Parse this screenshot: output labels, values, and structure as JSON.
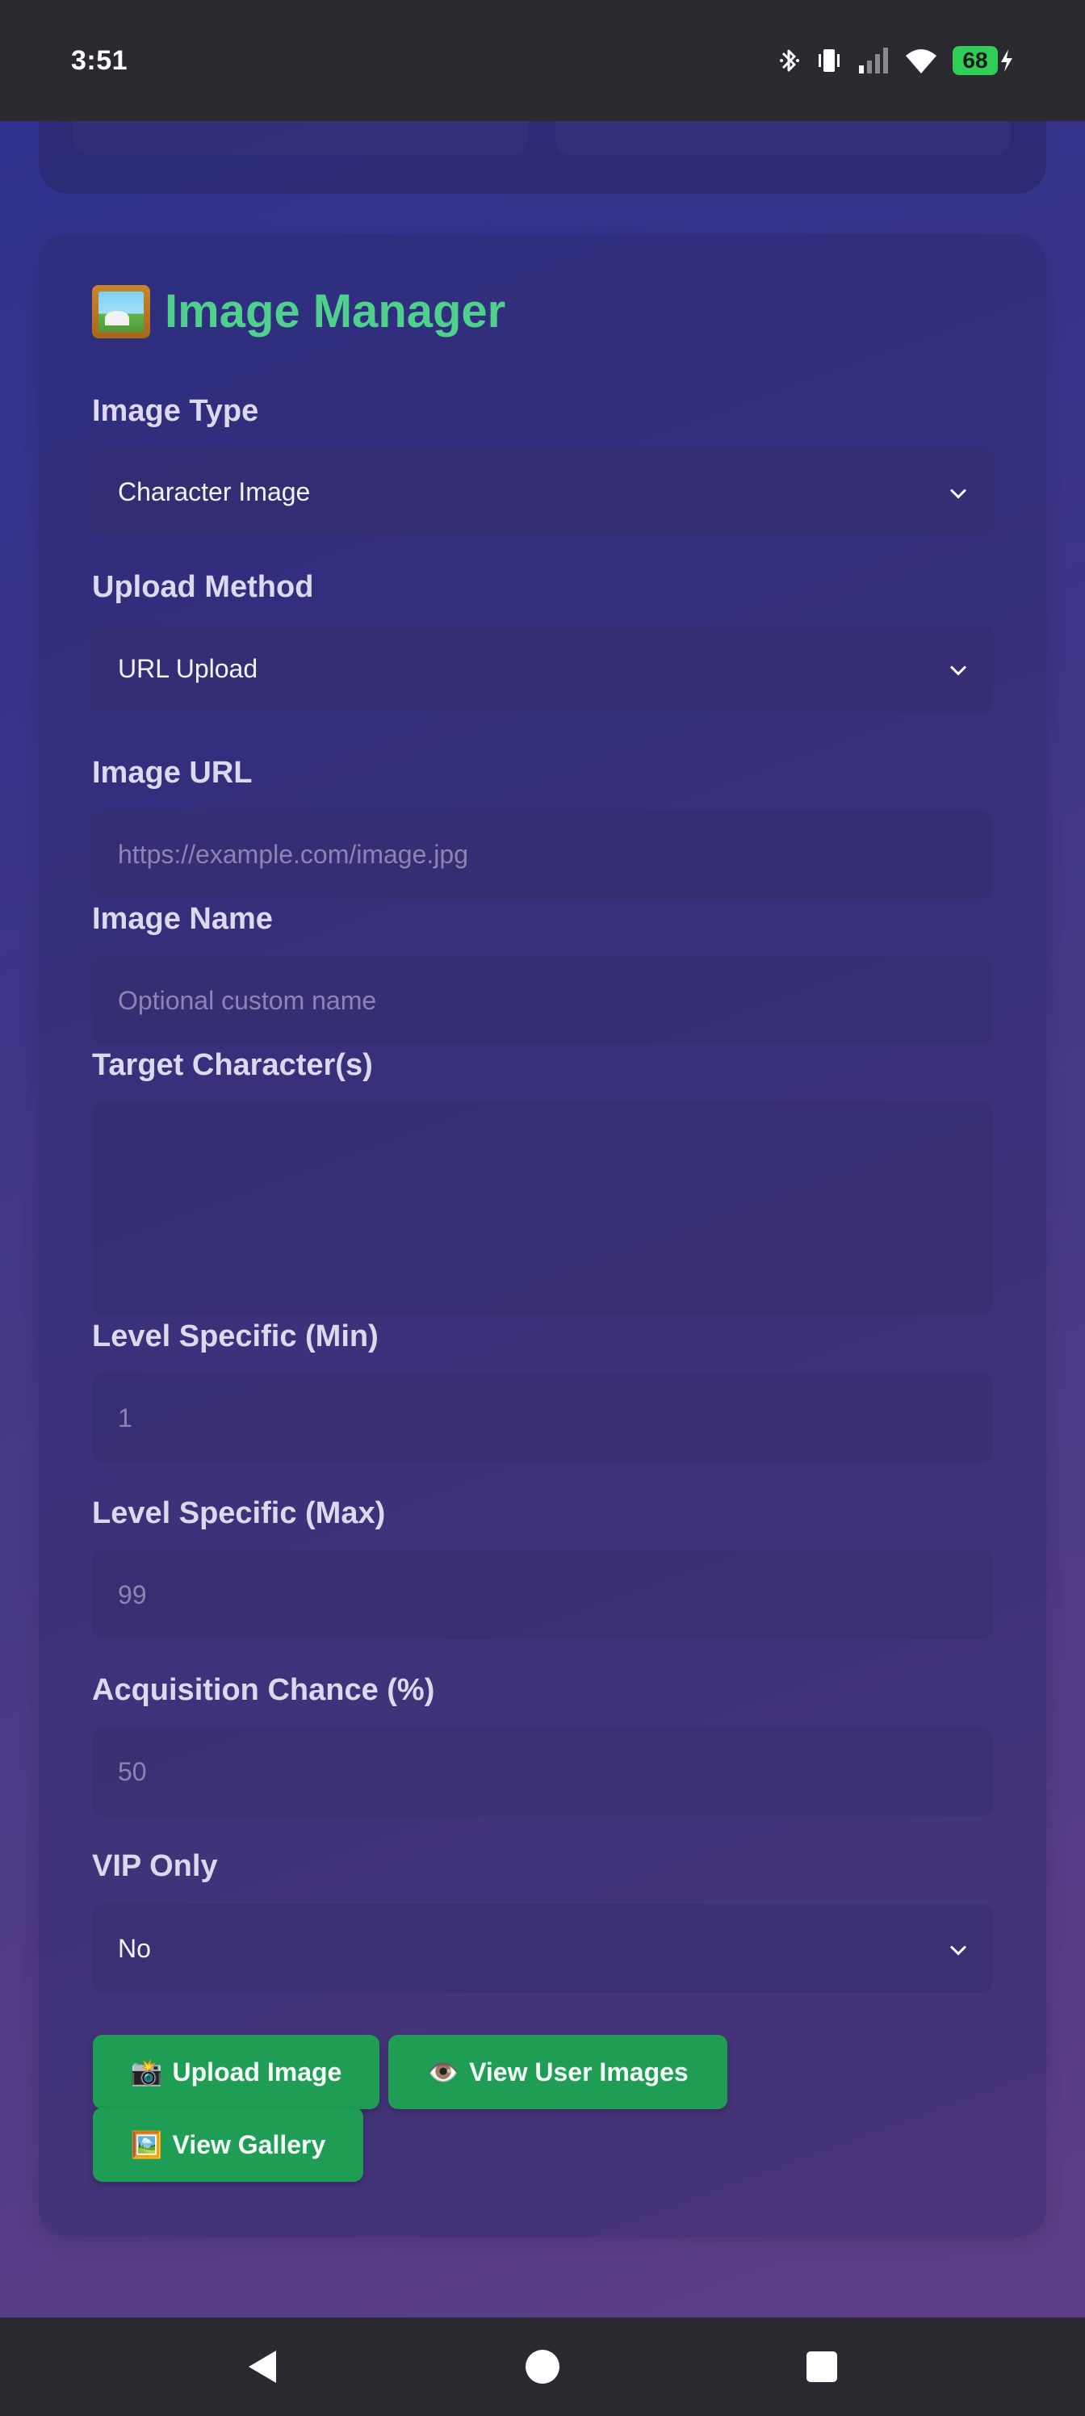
{
  "status_bar": {
    "time": "3:51",
    "battery_level": "68",
    "icons": [
      "bluetooth-icon",
      "vibrate-icon",
      "signal-icon",
      "wifi-icon",
      "battery-icon",
      "charging-icon"
    ]
  },
  "image_manager": {
    "title": "Image Manager",
    "title_icon": "framed-picture-icon",
    "accent_color": "#4fd18d",
    "fields": {
      "image_type": {
        "label": "Image Type",
        "value": "Character Image"
      },
      "upload_method": {
        "label": "Upload Method",
        "value": "URL Upload"
      },
      "image_url": {
        "label": "Image URL",
        "value": "",
        "placeholder": "https://example.com/image.jpg"
      },
      "image_name": {
        "label": "Image Name",
        "value": "",
        "placeholder": "Optional custom name"
      },
      "target_characters": {
        "label": "Target Character(s)",
        "value": ""
      },
      "level_min": {
        "label": "Level Specific (Min)",
        "value": "",
        "placeholder": "1"
      },
      "level_max": {
        "label": "Level Specific (Max)",
        "value": "",
        "placeholder": "99"
      },
      "acquisition_chance": {
        "label": "Acquisition Chance (%)",
        "value": "",
        "placeholder": "50"
      },
      "vip_only": {
        "label": "VIP Only",
        "value": "No"
      }
    },
    "buttons": {
      "upload": {
        "emoji": "📸",
        "label": "Upload Image"
      },
      "view_user_images": {
        "emoji": "👁️",
        "label": "View User Images"
      },
      "view_gallery": {
        "emoji": "🖼️",
        "label": "View Gallery"
      }
    },
    "button_color": "#1f9d55"
  },
  "nav_bar": {
    "icons": [
      "back-icon",
      "home-icon",
      "recents-icon"
    ]
  }
}
